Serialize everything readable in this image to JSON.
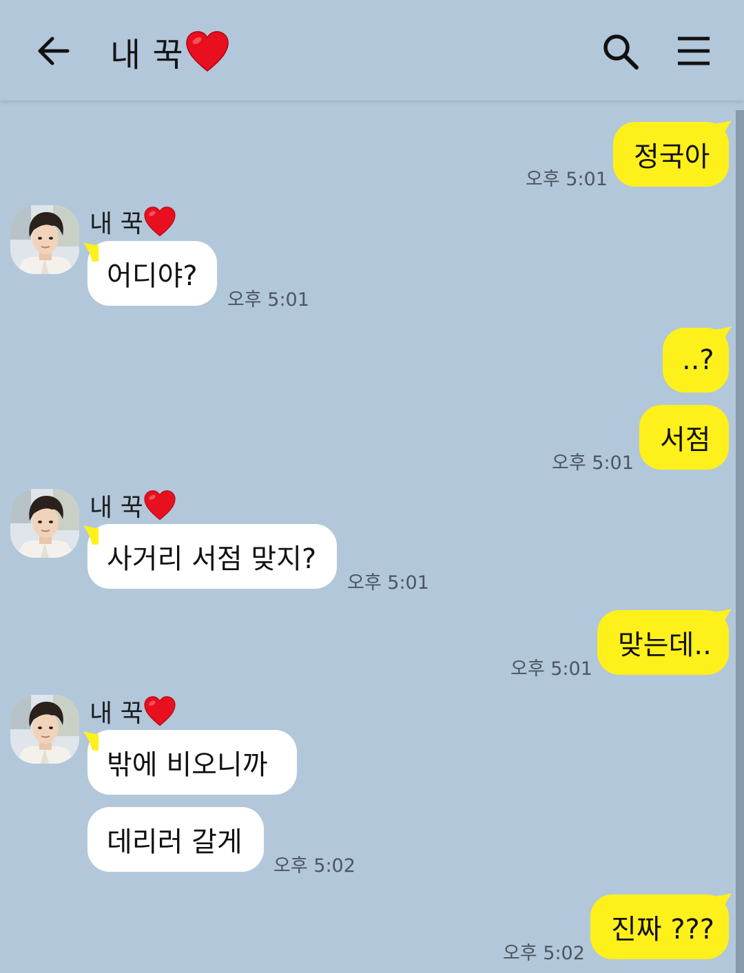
{
  "header": {
    "title": "내 꾹",
    "back_icon": "arrow-left-icon",
    "heart_icon": "red-heart-emoji",
    "search_icon": "search-icon",
    "menu_icon": "menu-icon"
  },
  "colors": {
    "background": "#b2c7da",
    "outgoing_bubble": "#fef01b",
    "incoming_bubble": "#ffffff",
    "heart": "#e8101f"
  },
  "messages": [
    {
      "direction": "out",
      "text": "정국아",
      "time": "오후 5:01"
    },
    {
      "direction": "in",
      "sender": "내 꾹",
      "text": "어디야?",
      "time": "오후 5:01"
    },
    {
      "direction": "out",
      "text": "..?",
      "time": ""
    },
    {
      "direction": "out",
      "text": "서점",
      "time": "오후 5:01"
    },
    {
      "direction": "in",
      "sender": "내 꾹",
      "text": "사거리 서점 맞지?",
      "time": "오후 5:01"
    },
    {
      "direction": "out",
      "text": "맞는데..",
      "time": "오후 5:01"
    },
    {
      "direction": "in",
      "sender": "내 꾹",
      "text": "밖에 비오니까",
      "time": ""
    },
    {
      "direction": "in",
      "text": "데리러 갈게",
      "time": "오후 5:02"
    },
    {
      "direction": "out",
      "text": "진짜 ???",
      "time": "오후 5:02"
    }
  ]
}
